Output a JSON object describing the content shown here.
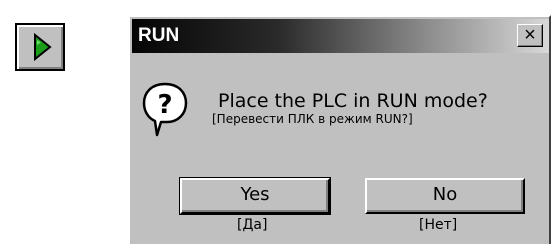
{
  "toolbar": {
    "run_button_icon": "play-triangle-icon",
    "run_button_color": "#1a9e1a"
  },
  "dialog": {
    "title": "RUN",
    "close_label": "×",
    "icon": "question-icon",
    "message": "Place the PLC in RUN mode?",
    "message_translation": "[Перевести ПЛК в режим RUN?]",
    "yes_label": "Yes",
    "yes_caption": "[Да]",
    "no_label": "No",
    "no_caption": "[Нет]"
  }
}
